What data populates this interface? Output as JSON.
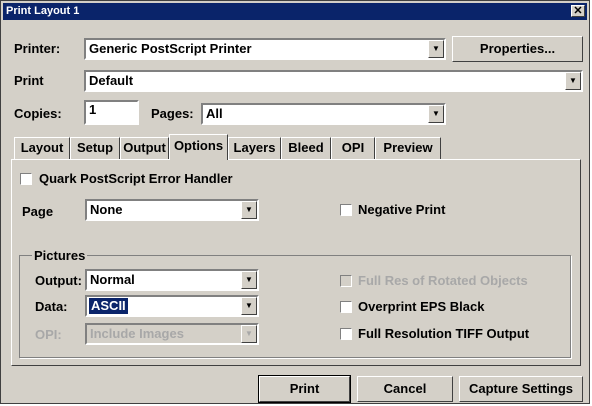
{
  "window": {
    "title": "Print Layout 1"
  },
  "top": {
    "printer_label": "Printer:",
    "printer_value": "Generic PostScript Printer",
    "properties_button": "Properties...",
    "print_label": "Print",
    "print_value": "Default",
    "copies_label": "Copies:",
    "copies_value": "1",
    "pages_label": "Pages:",
    "pages_value": "All"
  },
  "tabs": [
    {
      "label": "Layout"
    },
    {
      "label": "Setup"
    },
    {
      "label": "Output"
    },
    {
      "label": "Options",
      "active": true
    },
    {
      "label": "Layers"
    },
    {
      "label": "Bleed"
    },
    {
      "label": "OPI"
    },
    {
      "label": "Preview"
    }
  ],
  "options": {
    "quark_handler": {
      "label": "Quark PostScript Error Handler",
      "checked": false
    },
    "page_label": "Page",
    "page_value": "None",
    "negative_print": {
      "label": "Negative Print",
      "checked": false
    },
    "pictures": {
      "group_label": "Pictures",
      "output_label": "Output:",
      "output_value": "Normal",
      "data_label": "Data:",
      "data_value": "ASCII",
      "opi_label": "OPI:",
      "opi_value": "Include Images",
      "full_res_rotated": {
        "label": "Full Res of Rotated Objects",
        "checked": false,
        "enabled": false
      },
      "overprint_eps": {
        "label": "Overprint EPS Black",
        "checked": false
      },
      "full_res_tiff": {
        "label": "Full Resolution TIFF Output",
        "checked": false
      }
    }
  },
  "footer": {
    "print_button": "Print",
    "cancel_button": "Cancel",
    "capture_button": "Capture Settings"
  }
}
